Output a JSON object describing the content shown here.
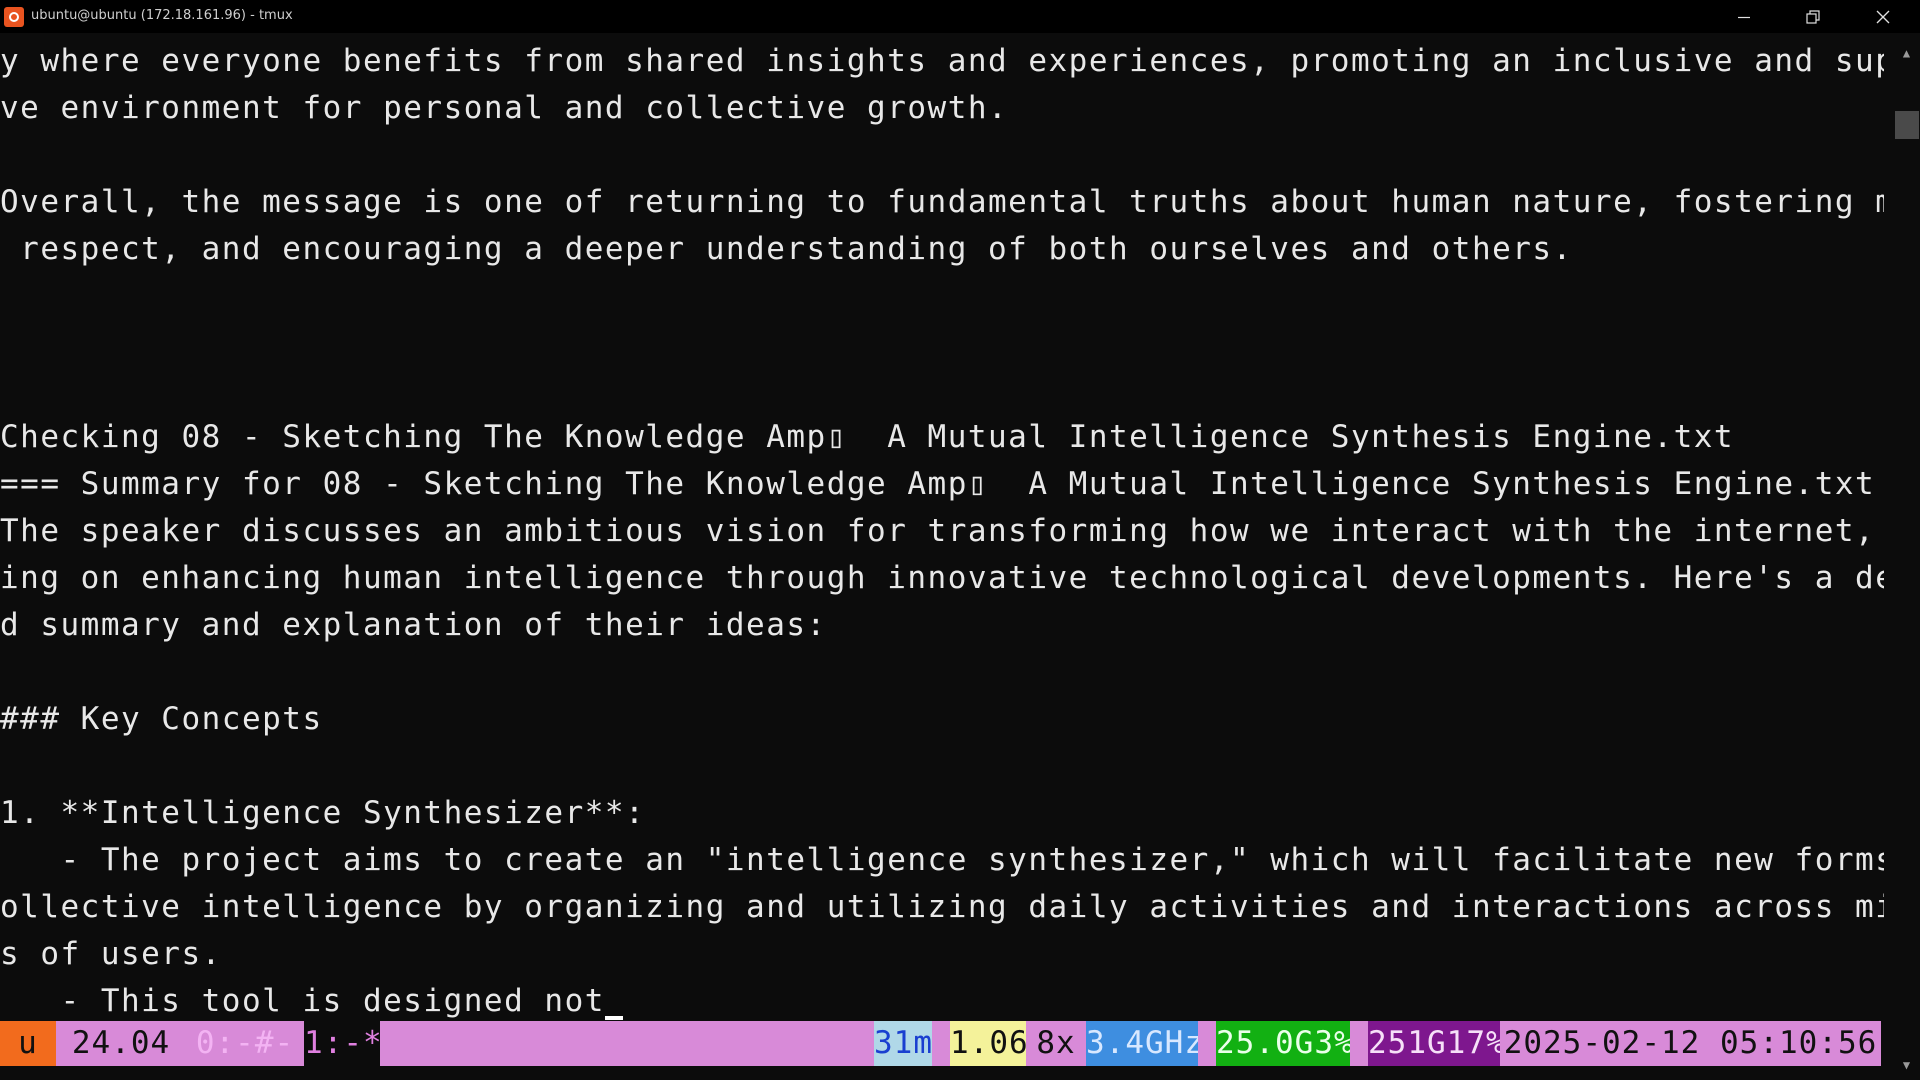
{
  "window": {
    "title": "ubuntu@ubuntu (172.18.161.96) - tmux",
    "controls": [
      "minimize",
      "maximize",
      "close"
    ]
  },
  "terminal": {
    "lines": [
      "y where everyone benefits from shared insights and experiences, promoting an inclusive and supporti",
      "ve environment for personal and collective growth.",
      "",
      "Overall, the message is one of returning to fundamental truths about human nature, fostering mutual",
      " respect, and encouraging a deeper understanding of both ourselves and others.",
      "",
      "",
      "",
      "Checking 08 - Sketching The Knowledge Amp▯  A Mutual Intelligence Synthesis Engine.txt",
      "=== Summary for 08 - Sketching The Knowledge Amp▯  A Mutual Intelligence Synthesis Engine.txt ===",
      "The speaker discusses an ambitious vision for transforming how we interact with the internet, focus",
      "ing on enhancing human intelligence through innovative technological developments. Here's a detaile",
      "d summary and explanation of their ideas:",
      "",
      "### Key Concepts",
      "",
      "1. **Intelligence Synthesizer**:",
      "   - The project aims to create an \"intelligence synthesizer,\" which will facilitate new forms of c",
      "ollective intelligence by organizing and utilizing daily activities and interactions across million",
      "s of users.",
      "   - This tool is designed not"
    ]
  },
  "statusbar": {
    "session": "u",
    "os_version": "24.04",
    "window_index": "0:-#-",
    "window_active": "1:-*",
    "uptime": "31m",
    "load": "1.06",
    "cpu_count": "8x",
    "cpu_freq": "3.4GHz",
    "memory": "25.0G3%",
    "disk": "251G17%",
    "datetime": "2025-02-12 05:10:56"
  },
  "colors": {
    "background": "#0c0c0c",
    "text": "#e8e8e8",
    "session_bg": "#f26b1d",
    "version_bg": "#d88ad8",
    "window_inactive_fg": "#f3b3f3",
    "window_active_bg": "#d88ad8",
    "uptime_bg": "#b0d8e8",
    "load_bg": "#f4f29a",
    "cpu_count_bg": "#d88ad8",
    "cpu_freq_bg": "#3e8ee0",
    "memory_bg": "#12b012",
    "disk_bg": "#7e178e",
    "datetime_bg": "#d88ad8"
  }
}
